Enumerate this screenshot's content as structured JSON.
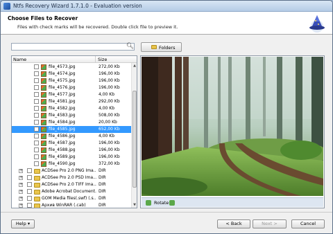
{
  "window": {
    "title": "Ntfs Recovery Wizard 1.7.1.0 - Evaluation version"
  },
  "header": {
    "title": "Choose Files to Recover",
    "subtitle": "Files with check marks will be recovered. Double click file to preview it."
  },
  "toolbar": {
    "folders_label": "Folders",
    "search_icon": "magnifier-icon"
  },
  "tree": {
    "columns": [
      "Name",
      "Size"
    ],
    "rows": [
      {
        "name": "file_4573.jpg",
        "size": "272,00 Kb",
        "type": "file"
      },
      {
        "name": "file_4574.jpg",
        "size": "196,00 Kb",
        "type": "file"
      },
      {
        "name": "file_4575.jpg",
        "size": "196,00 Kb",
        "type": "file"
      },
      {
        "name": "file_4576.jpg",
        "size": "196,00 Kb",
        "type": "file"
      },
      {
        "name": "file_4577.jpg",
        "size": "4,00 Kb",
        "type": "file"
      },
      {
        "name": "file_4581.jpg",
        "size": "292,00 Kb",
        "type": "file"
      },
      {
        "name": "file_4582.jpg",
        "size": "4,00 Kb",
        "type": "file"
      },
      {
        "name": "file_4583.jpg",
        "size": "508,00 Kb",
        "type": "file"
      },
      {
        "name": "file_4584.jpg",
        "size": "20,00 Kb",
        "type": "file"
      },
      {
        "name": "file_4585.jpg",
        "size": "652,00 Kb",
        "type": "file",
        "selected": true
      },
      {
        "name": "file_4586.jpg",
        "size": "4,00 Kb",
        "type": "file"
      },
      {
        "name": "file_4587.jpg",
        "size": "196,00 Kb",
        "type": "file"
      },
      {
        "name": "file_4588.jpg",
        "size": "196,00 Kb",
        "type": "file"
      },
      {
        "name": "file_4589.jpg",
        "size": "196,00 Kb",
        "type": "file"
      },
      {
        "name": "file_4590.jpg",
        "size": "372,00 Kb",
        "type": "file"
      },
      {
        "name": "ACDSee Pro 2.0 PNG Ima...",
        "size": "DIR",
        "type": "dir"
      },
      {
        "name": "ACDSee Pro 2.0 PSD Ima...",
        "size": "DIR",
        "type": "dir"
      },
      {
        "name": "ACDSee Pro 2.0 TIFF Ima...",
        "size": "DIR",
        "type": "dir"
      },
      {
        "name": "Adobe Acrobat Document...",
        "size": "DIR",
        "type": "dir"
      },
      {
        "name": "GOM Media files(.swf) (.s...",
        "size": "DIR",
        "type": "dir"
      },
      {
        "name": "Архив WinRAR (.cab)",
        "size": "DIR",
        "type": "dir"
      }
    ]
  },
  "preview": {
    "rotate_label": "Rotate"
  },
  "footer": {
    "help_label": "Help",
    "back_label": "< Back",
    "next_label": "Next >",
    "cancel_label": "Cancel"
  },
  "colors": {
    "selection": "#3399ff",
    "titlebar": "#c6d9ee"
  }
}
